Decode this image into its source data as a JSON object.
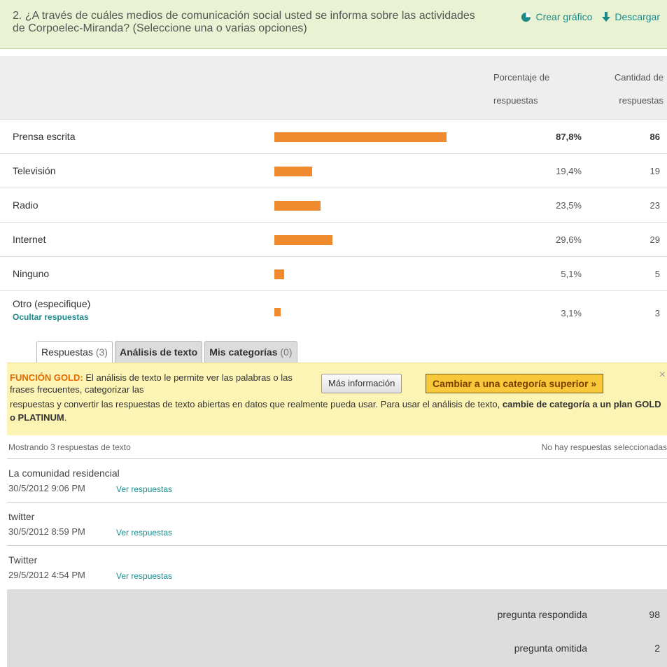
{
  "question": {
    "title": "2. ¿A través de cuáles medios de comunicación social usted se informa sobre las actividades de Corpoelec-Miranda? (Seleccione una o varias opciones)",
    "create_chart_label": "Crear gráfico",
    "download_label": "Descargar"
  },
  "table_header": {
    "percent_col": "Porcentaje de respuestas",
    "count_col": "Cantidad de respuestas"
  },
  "chart_data": {
    "type": "bar",
    "categories": [
      "Prensa escrita",
      "Televisión",
      "Radio",
      "Internet",
      "Ninguno",
      "Otro (especifique)"
    ],
    "values": [
      87.8,
      19.4,
      23.5,
      29.6,
      5.1,
      3.1
    ],
    "percent_labels": [
      "87,8%",
      "19,4%",
      "23,5%",
      "29,6%",
      "5,1%",
      "3,1%"
    ],
    "counts": [
      86,
      19,
      23,
      29,
      5,
      3
    ],
    "colors": {
      "bar": "#f08a2e"
    }
  },
  "other_row": {
    "hide_responses_label": "Ocultar respuestas"
  },
  "tabs": [
    {
      "label": "Respuestas",
      "count": "(3)"
    },
    {
      "label": "Análisis de texto",
      "count": ""
    },
    {
      "label": "Mis categorías",
      "count": "(0)"
    }
  ],
  "gold_banner": {
    "tag": "FUNCIÓN GOLD:",
    "text_a": " El análisis de texto le permite ver las palabras o las frases frecuentes, categorizar las",
    "text_b": "respuestas y convertir las respuestas de texto abiertas en datos que realmente pueda usar. Para usar el análisis de texto, ",
    "text_bold": "cambie de categoría a un plan GOLD o PLATINUM",
    "text_end": ".",
    "more_info_label": "Más información",
    "upgrade_label": "Cambiar a una categoría superior »",
    "close_glyph": "×"
  },
  "list_header": {
    "left": "Mostrando 3 respuestas de texto",
    "right": "No hay respuestas seleccionadas"
  },
  "responses": [
    {
      "text": "La comunidad residencial",
      "date": "30/5/2012 9:06 PM",
      "link": "Ver respuestas"
    },
    {
      "text": "twitter",
      "date": "30/5/2012 8:59 PM",
      "link": "Ver respuestas"
    },
    {
      "text": "Twitter",
      "date": "29/5/2012 4:54 PM",
      "link": "Ver respuestas"
    }
  ],
  "summary": {
    "answered_label": "pregunta respondida",
    "answered_value": "98",
    "skipped_label": "pregunta omitida",
    "skipped_value": "2"
  }
}
